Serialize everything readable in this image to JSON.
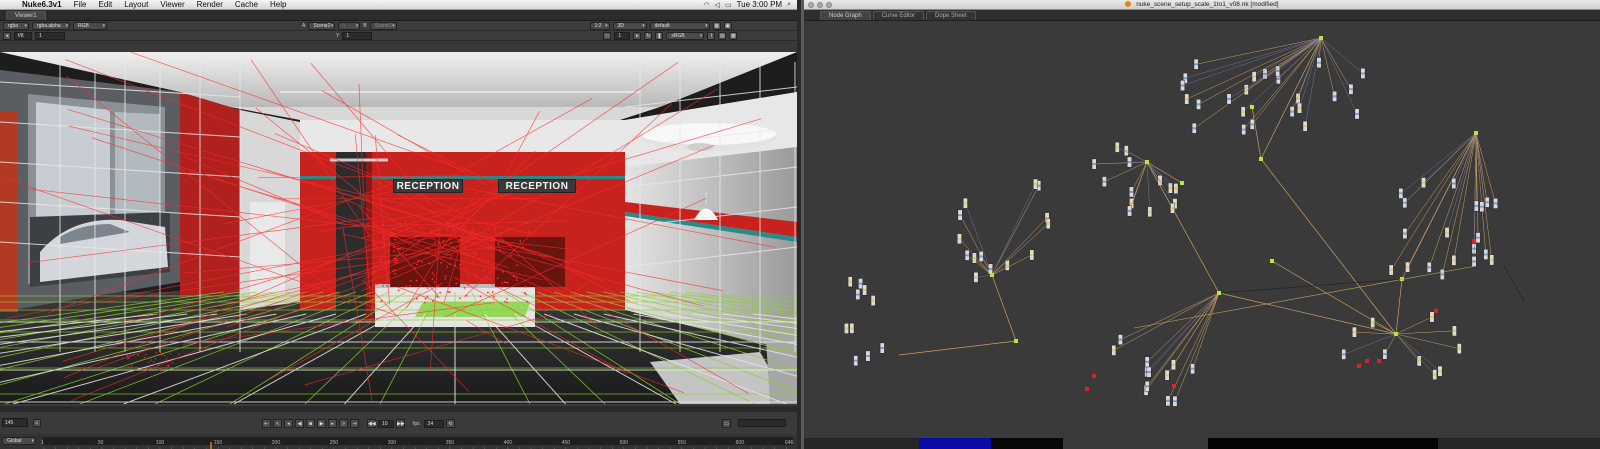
{
  "menubar": {
    "app_name": "Nuke6.3v1",
    "menus": [
      "File",
      "Edit",
      "Layout",
      "Viewer",
      "Render",
      "Cache",
      "Help"
    ],
    "clock": "Tue 3:00 PM",
    "status_icons": [
      "wifi-icon",
      "volume-icon",
      "battery-icon",
      "spotlight-icon"
    ]
  },
  "viewer": {
    "tab_label": "Viewer1",
    "channels": "rgba",
    "alpha_channel": "rgba.alpha",
    "colorspace_display": "RGB",
    "input_a_label": "A",
    "input_a": "Scene2",
    "input_a_op": "-",
    "input_b_label": "B",
    "input_b": "Scene2",
    "downrez": "1:2",
    "view_mode": "3D",
    "camera": "default",
    "fstop": "f/8",
    "gain": "1",
    "y_label": "Y",
    "gamma": "1",
    "proxy": "1",
    "lut": "sRGB",
    "signs": [
      "RECEPTION",
      "RECEPTION"
    ]
  },
  "transport": {
    "current_frame": "145",
    "step": "10",
    "fps_label": "fps",
    "fps": "24"
  },
  "timeline": {
    "scope": "Global",
    "ticks": [
      "1",
      "50",
      "100",
      "150",
      "200",
      "250",
      "300",
      "350",
      "400",
      "450",
      "500",
      "550",
      "600",
      "646"
    ],
    "range": [
      1,
      646
    ],
    "current": 145
  },
  "nodegraph": {
    "window_title": "nuke_scene_setup_scale_1to1_v08.nk [modified]",
    "tabs": [
      "Node Graph",
      "Curve Editor",
      "Dope Sheet"
    ]
  },
  "colors": {
    "wire": "#c9a064",
    "wire_dark": "#222222",
    "dot": "#b6e83a",
    "red_node": "#d82424",
    "wall_red": "#c8221f",
    "grid_green": "#8cd02e",
    "grid_white": "#e8e8e8"
  }
}
